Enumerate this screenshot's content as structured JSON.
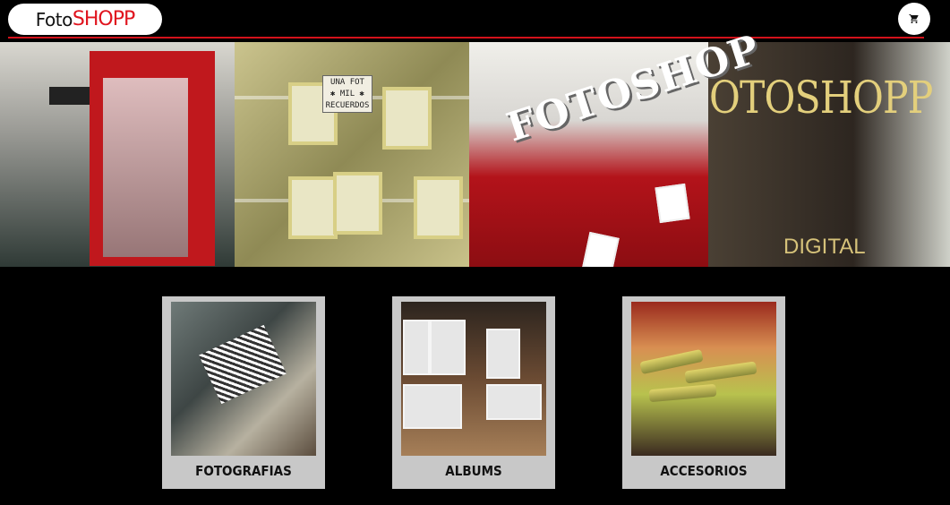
{
  "header": {
    "logo_part1": "Foto",
    "logo_part2": "SHOPP",
    "cart_icon": "shopping-cart-icon"
  },
  "hero": {
    "panel2_sign": [
      "UNA FOT",
      "✱ MIL ✱",
      "RECUERDOS"
    ],
    "panel3_word": "FOTOSHOP",
    "panel4_word": "OTOSHOPP",
    "panel4_sub": "DIGITAL"
  },
  "categories": [
    {
      "label": "FOTOGRAFIAS"
    },
    {
      "label": "ALBUMS"
    },
    {
      "label": "ACCESORIOS"
    }
  ],
  "colors": {
    "background": "#000000",
    "brand_red": "#d3121b",
    "card_gray": "#c8c8c8"
  }
}
